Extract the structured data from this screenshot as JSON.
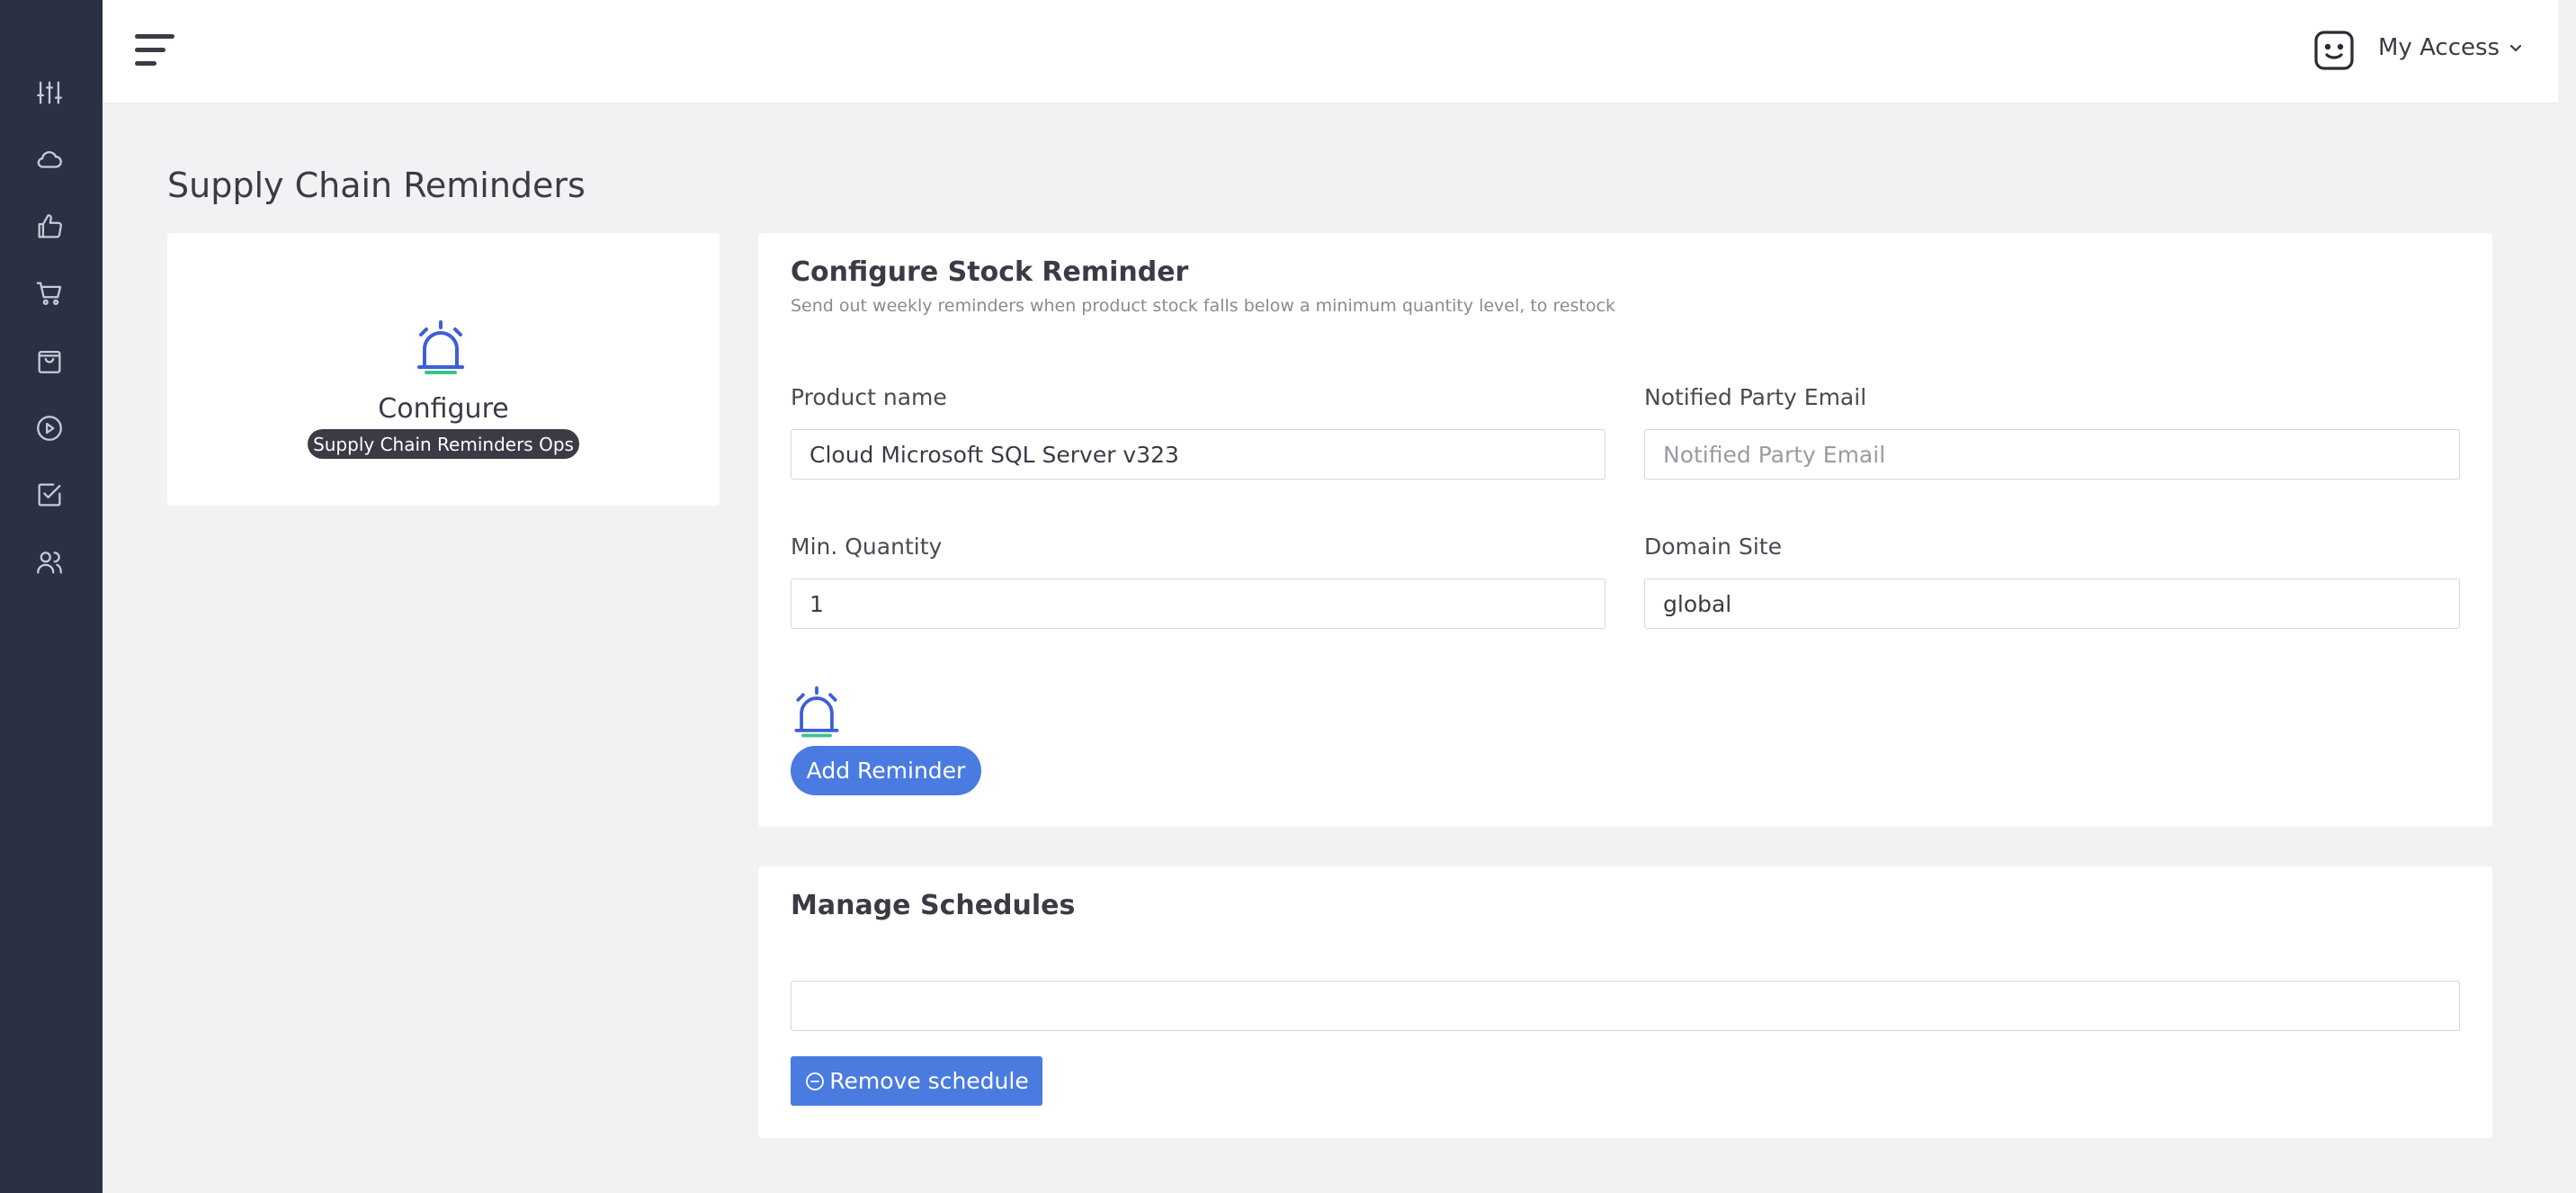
{
  "sidebar": {
    "items": [
      {
        "icon": "sliders-icon"
      },
      {
        "icon": "cloud-icon"
      },
      {
        "icon": "thumbs-up-icon"
      },
      {
        "icon": "cart-icon"
      },
      {
        "icon": "shopping-bag-icon"
      },
      {
        "icon": "play-circle-icon"
      },
      {
        "icon": "check-square-icon"
      },
      {
        "icon": "users-icon"
      }
    ]
  },
  "header": {
    "menu_icon": "hamburger-icon",
    "account_label": "My Access",
    "avatar_icon": "smiley-icon"
  },
  "page": {
    "title": "Supply Chain Reminders"
  },
  "left_card": {
    "icon": "bell-icon",
    "title": "Configure",
    "badge": "Supply Chain Reminders Ops"
  },
  "configure": {
    "title": "Configure Stock Reminder",
    "subtitle": "Send out weekly reminders when product stock falls below a minimum quantity level, to restock",
    "product_name_label": "Product name",
    "product_name_value": "Cloud Microsoft SQL Server v323",
    "email_label": "Notified Party Email",
    "email_placeholder": "Notified Party Email",
    "email_value": "",
    "min_qty_label": "Min. Quantity",
    "min_qty_value": "1",
    "domain_label": "Domain Site",
    "domain_value": "global",
    "add_button": "Add Reminder"
  },
  "manage": {
    "title": "Manage Schedules",
    "remove_button": "Remove schedule"
  },
  "colors": {
    "sidebar": "#2b3145",
    "primary": "#4a7be0",
    "bell_blue": "#3d5fd6",
    "bell_green": "#3cc38a"
  }
}
